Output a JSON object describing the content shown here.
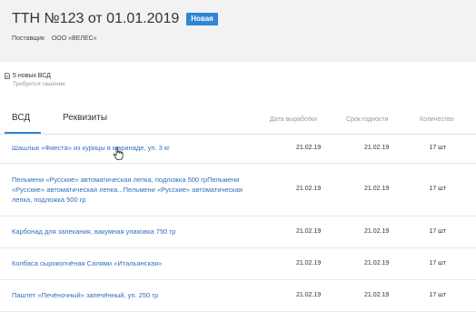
{
  "header": {
    "title": "ТТН №123 от 01.01.2019",
    "badge": "Новая",
    "supplier_label": "Поставщик",
    "supplier_value": "ООО «ВЕЛЕС»"
  },
  "info": {
    "icon": "document-icon",
    "line1": "5 новых ВСД",
    "line2": "Требуется гашение"
  },
  "tabs": [
    {
      "label": "ВСД",
      "active": true
    },
    {
      "label": "Реквизиты",
      "active": false
    }
  ],
  "columns": {
    "production_date": "Дата выработки",
    "expiry": "Срок годности",
    "quantity": "Количество"
  },
  "rows": [
    {
      "name": "Шашлык «Фиеста» из курицы в маринаде, уп. 3 кг",
      "production_date": "21.02.19",
      "expiry": "21.02.19",
      "quantity": "17 шт"
    },
    {
      "name": "Пельмени «Русские» автоматическая лепка, подложка 500 грПельмени «Русские» автоматическая лепка...Пельмени «Русские» автоматическая лепка, подложка 500 гр",
      "production_date": "21.02.19",
      "expiry": "21.02.19",
      "quantity": "17 шт"
    },
    {
      "name": "Карбонад для запекания, вакумная упаковка 750 гр",
      "production_date": "21.02.19",
      "expiry": "21.02.19",
      "quantity": "17 шт"
    },
    {
      "name": "Колбаса сырокопчёная Салями «Итальянская»",
      "production_date": "21.02.19",
      "expiry": "21.02.19",
      "quantity": "17 шт"
    },
    {
      "name": "Паштет «Печёночный» запечённый, уп. 250 гр",
      "production_date": "21.02.19",
      "expiry": "21.02.19",
      "quantity": "17 шт"
    }
  ],
  "colors": {
    "accent": "#2f86d3",
    "link": "#2f6fbf",
    "header_bg": "#f2f2f2"
  }
}
